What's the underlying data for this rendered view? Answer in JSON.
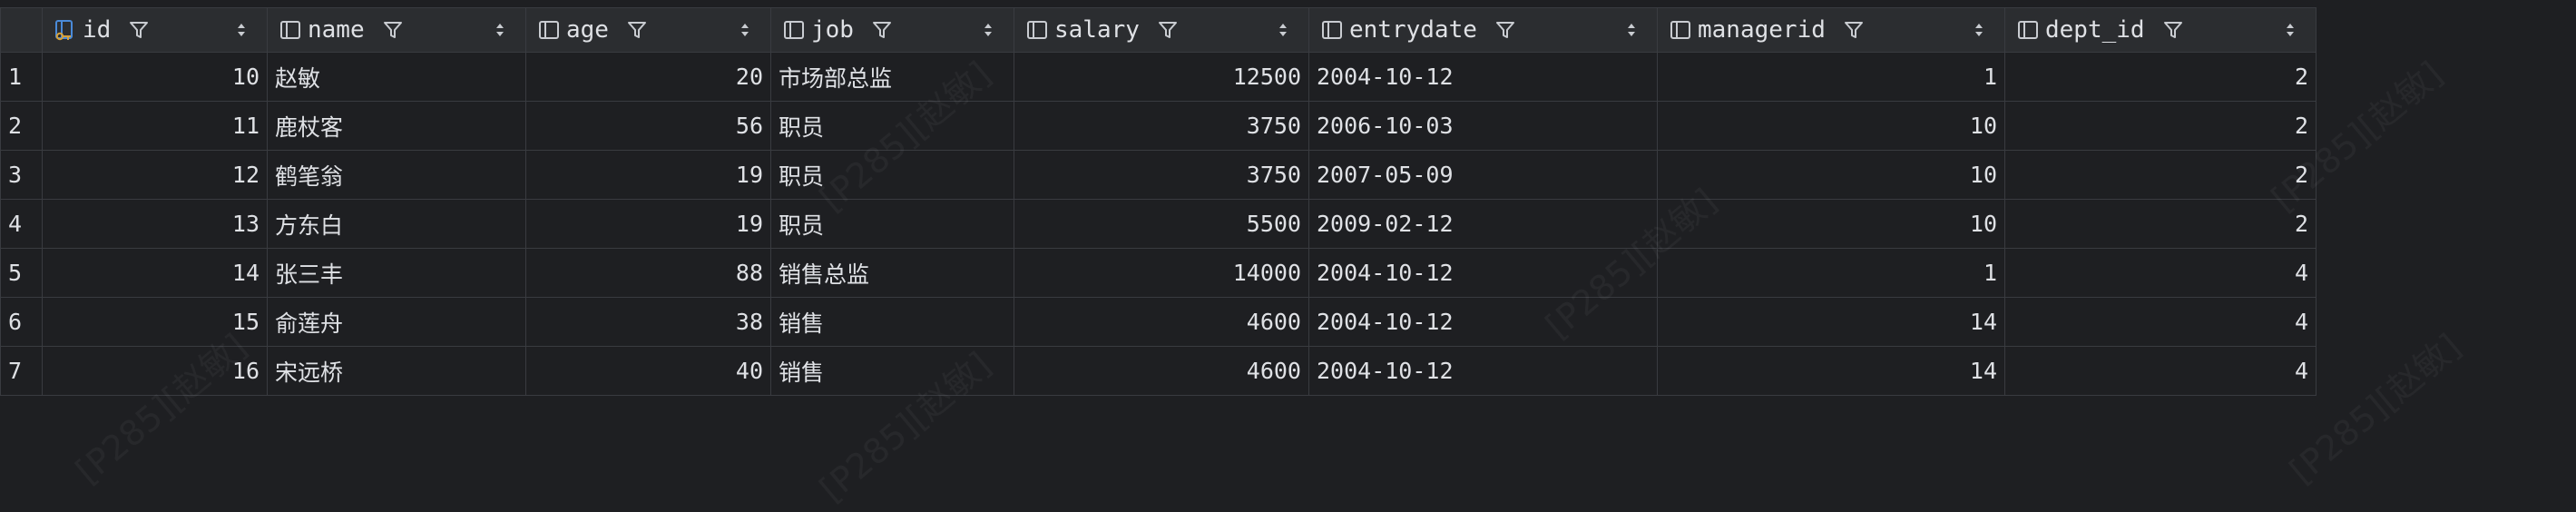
{
  "columns": [
    {
      "label": "id",
      "icon": "primary-key-column-icon"
    },
    {
      "label": "name",
      "icon": "column-icon"
    },
    {
      "label": "age",
      "icon": "column-icon"
    },
    {
      "label": "job",
      "icon": "column-icon"
    },
    {
      "label": "salary",
      "icon": "column-icon"
    },
    {
      "label": "entrydate",
      "icon": "column-icon"
    },
    {
      "label": "managerid",
      "icon": "column-icon"
    },
    {
      "label": "dept_id",
      "icon": "column-icon"
    }
  ],
  "rows": [
    {
      "num": "1",
      "id": "10",
      "name": "赵敏",
      "age": "20",
      "job": "市场部总监",
      "salary": "12500",
      "entrydate": "2004-10-12",
      "managerid": "1",
      "dept_id": "2"
    },
    {
      "num": "2",
      "id": "11",
      "name": "鹿杖客",
      "age": "56",
      "job": "职员",
      "salary": "3750",
      "entrydate": "2006-10-03",
      "managerid": "10",
      "dept_id": "2"
    },
    {
      "num": "3",
      "id": "12",
      "name": "鹤笔翁",
      "age": "19",
      "job": "职员",
      "salary": "3750",
      "entrydate": "2007-05-09",
      "managerid": "10",
      "dept_id": "2"
    },
    {
      "num": "4",
      "id": "13",
      "name": "方东白",
      "age": "19",
      "job": "职员",
      "salary": "5500",
      "entrydate": "2009-02-12",
      "managerid": "10",
      "dept_id": "2"
    },
    {
      "num": "5",
      "id": "14",
      "name": "张三丰",
      "age": "88",
      "job": "销售总监",
      "salary": "14000",
      "entrydate": "2004-10-12",
      "managerid": "1",
      "dept_id": "4"
    },
    {
      "num": "6",
      "id": "15",
      "name": "俞莲舟",
      "age": "38",
      "job": "销售",
      "salary": "4600",
      "entrydate": "2004-10-12",
      "managerid": "14",
      "dept_id": "4"
    },
    {
      "num": "7",
      "id": "16",
      "name": "宋远桥",
      "age": "40",
      "job": "销售",
      "salary": "4600",
      "entrydate": "2004-10-12",
      "managerid": "14",
      "dept_id": "4"
    }
  ],
  "watermark": "[P285][赵敏]",
  "colors": {
    "background": "#1e1f22",
    "header_background": "#2b2d30",
    "grid_line": "#393b40",
    "text": "#dfe1e5",
    "row_number": "#5a5d63",
    "key_icon_accent": "#d6a13b"
  }
}
